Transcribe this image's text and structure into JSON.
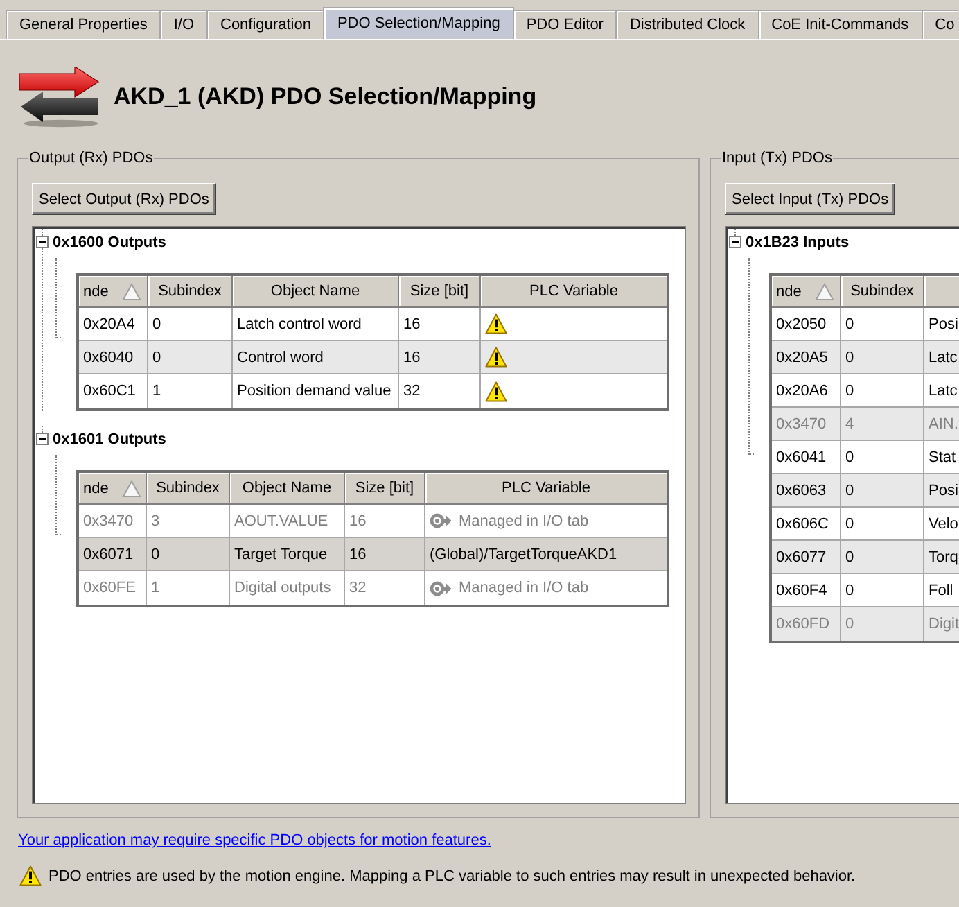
{
  "tabs": [
    {
      "label": "General Properties",
      "selected": false
    },
    {
      "label": "I/O",
      "selected": false
    },
    {
      "label": "Configuration",
      "selected": false
    },
    {
      "label": "PDO Selection/Mapping",
      "selected": true
    },
    {
      "label": "PDO Editor",
      "selected": false
    },
    {
      "label": "Distributed Clock",
      "selected": false
    },
    {
      "label": "CoE Init-Commands",
      "selected": false
    },
    {
      "label": "Co",
      "selected": false
    }
  ],
  "header": {
    "title": "AKD_1 (AKD) PDO Selection/Mapping"
  },
  "groups": [
    {
      "legend": "Output (Rx) PDOs",
      "button": "Select Output (Rx) PDOs",
      "tree": [
        {
          "label": "0x1600 Outputs",
          "expanded": true,
          "table": {
            "columns": [
              {
                "label": "nde",
                "sorted": true
              },
              {
                "label": "Subindex",
                "sorted": false
              },
              {
                "label": "Object Name",
                "sorted": false
              },
              {
                "label": "Size [bit]",
                "sorted": false
              },
              {
                "label": "PLC Variable",
                "sorted": false
              }
            ],
            "rows": [
              {
                "index": "0x20A4",
                "subindex": "0",
                "object_name": "Latch control word",
                "size": "16",
                "plc_variable": {
                  "kind": "warning"
                },
                "selected": false,
                "disabled": false
              },
              {
                "index": "0x6040",
                "subindex": "0",
                "object_name": "Control word",
                "size": "16",
                "plc_variable": {
                  "kind": "warning"
                },
                "selected": false,
                "disabled": false
              },
              {
                "index": "0x60C1",
                "subindex": "1",
                "object_name": "Position demand value",
                "size": "32",
                "plc_variable": {
                  "kind": "warning"
                },
                "selected": false,
                "disabled": false
              }
            ]
          }
        },
        {
          "label": "0x1601 Outputs",
          "expanded": true,
          "table": {
            "columns": [
              {
                "label": "nde",
                "sorted": true
              },
              {
                "label": "Subindex",
                "sorted": false
              },
              {
                "label": "Object Name",
                "sorted": false
              },
              {
                "label": "Size [bit]",
                "sorted": false
              },
              {
                "label": "PLC Variable",
                "sorted": false
              }
            ],
            "rows": [
              {
                "index": "0x3470",
                "subindex": "3",
                "object_name": "AOUT.VALUE",
                "size": "16",
                "plc_variable": {
                  "kind": "managed",
                  "text": "Managed in I/O tab"
                },
                "selected": false,
                "disabled": true
              },
              {
                "index": "0x6071",
                "subindex": "0",
                "object_name": "Target Torque",
                "size": "16",
                "plc_variable": {
                  "kind": "variable",
                  "text": "(Global)/TargetTorqueAKD1"
                },
                "selected": true,
                "disabled": false
              },
              {
                "index": "0x60FE",
                "subindex": "1",
                "object_name": "Digital outputs",
                "size": "32",
                "plc_variable": {
                  "kind": "managed",
                  "text": "Managed in I/O tab"
                },
                "selected": false,
                "disabled": true
              }
            ]
          }
        }
      ]
    },
    {
      "legend": "Input (Tx) PDOs",
      "button": "Select Input (Tx) PDOs",
      "tree": [
        {
          "label": "0x1B23 Inputs",
          "expanded": true,
          "table": {
            "columns": [
              {
                "label": "nde",
                "sorted": true
              },
              {
                "label": "Subindex",
                "sorted": false
              },
              {
                "sorted": false
              }
            ],
            "rows": [
              {
                "index": "0x2050",
                "subindex": "0",
                "object_name": "Posi",
                "selected": false,
                "disabled": false
              },
              {
                "index": "0x20A5",
                "subindex": "0",
                "object_name": "Latc",
                "selected": false,
                "disabled": false
              },
              {
                "index": "0x20A6",
                "subindex": "0",
                "object_name": "Latc",
                "selected": false,
                "disabled": false
              },
              {
                "index": "0x3470",
                "subindex": "4",
                "object_name": "AIN.",
                "selected": false,
                "disabled": true
              },
              {
                "index": "0x6041",
                "subindex": "0",
                "object_name": "Stat",
                "selected": false,
                "disabled": false
              },
              {
                "index": "0x6063",
                "subindex": "0",
                "object_name": "Posi",
                "selected": false,
                "disabled": false
              },
              {
                "index": "0x606C",
                "subindex": "0",
                "object_name": "Velo",
                "selected": false,
                "disabled": false
              },
              {
                "index": "0x6077",
                "subindex": "0",
                "object_name": "Torq",
                "selected": false,
                "disabled": false
              },
              {
                "index": "0x60F4",
                "subindex": "0",
                "object_name": "Foll",
                "selected": false,
                "disabled": false
              },
              {
                "index": "0x60FD",
                "subindex": "0",
                "object_name": "Digit",
                "selected": false,
                "disabled": true
              }
            ]
          }
        }
      ]
    }
  ],
  "footer": {
    "link": "Your application may require specific PDO objects for motion features.",
    "warning": "PDO entries are used by the motion engine. Mapping a PLC variable to such entries may result in unexpected behavior."
  }
}
